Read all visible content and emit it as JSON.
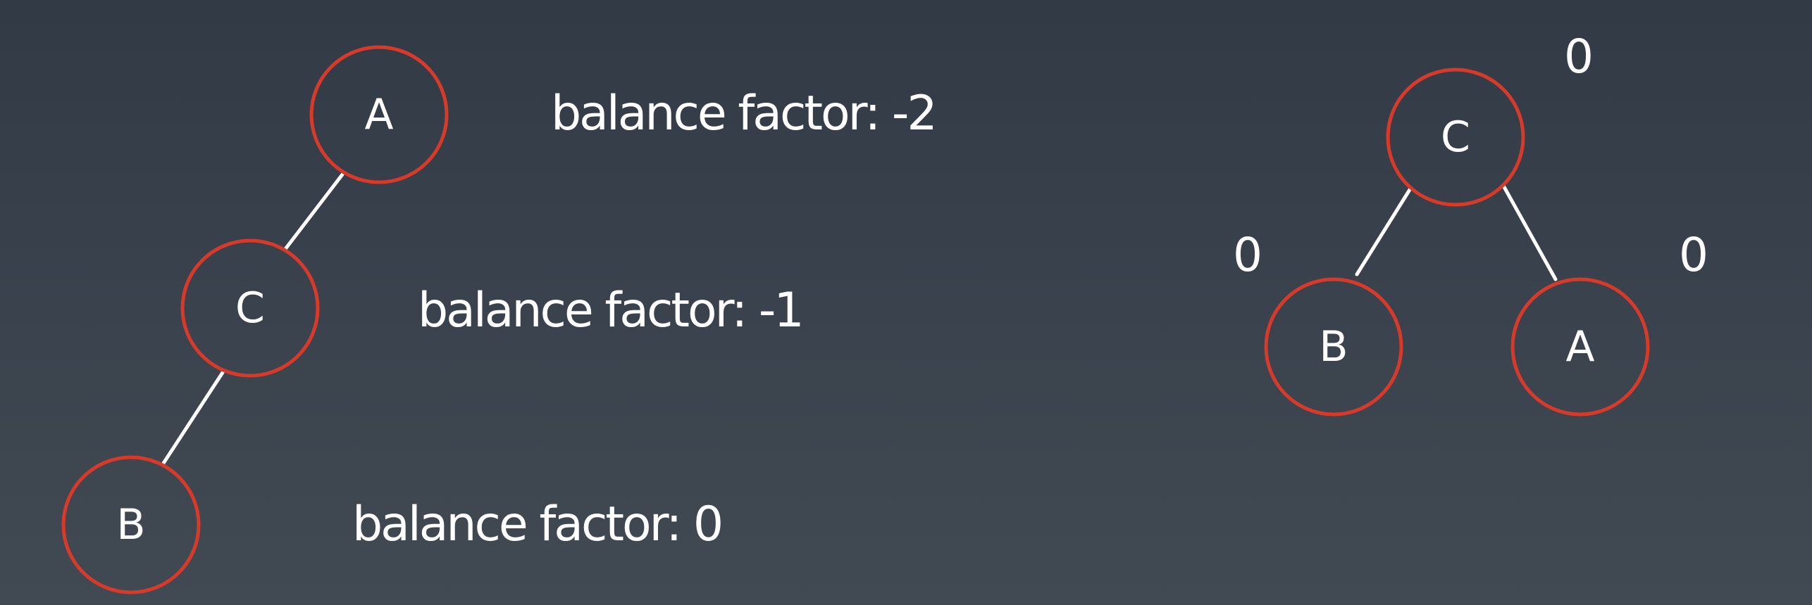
{
  "left_tree": {
    "nodes": {
      "a": "A",
      "c": "C",
      "b": "B"
    },
    "balance_labels": {
      "a": "balance factor: -2",
      "c": "balance factor: -1",
      "b": "balance factor: 0"
    }
  },
  "right_tree": {
    "nodes": {
      "c": "C",
      "b": "B",
      "a": "A"
    },
    "balance_factors": {
      "c": "0",
      "b": "0",
      "a": "0"
    }
  },
  "colors": {
    "node_stroke": "#d83a2a",
    "edge": "#ffffff",
    "text": "#ffffff"
  }
}
